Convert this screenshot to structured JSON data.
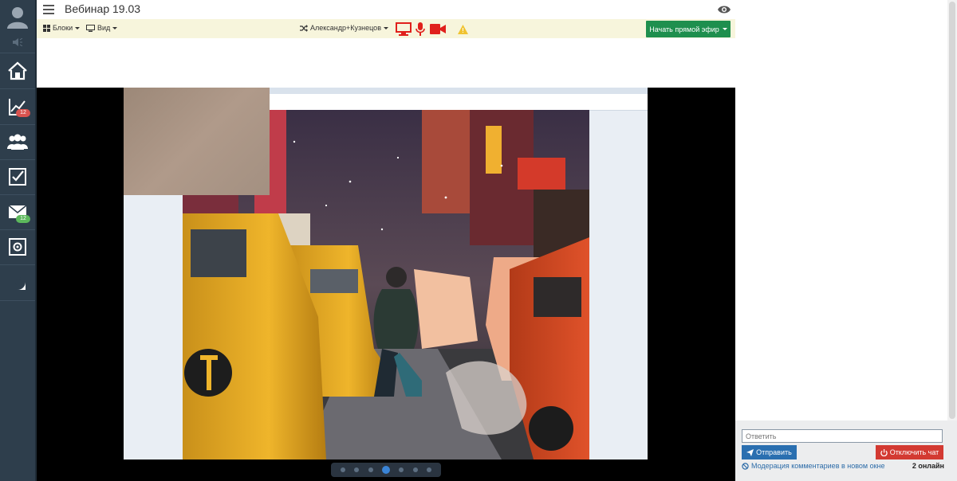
{
  "header": {
    "title": "Вебинар 19.03"
  },
  "sidebar": {
    "items": [
      {
        "icon": "user-avatar-icon"
      },
      {
        "icon": "volume-icon"
      },
      {
        "icon": "home-icon"
      },
      {
        "icon": "chart-icon",
        "badge": "12"
      },
      {
        "icon": "users-icon"
      },
      {
        "icon": "checkbox-icon"
      },
      {
        "icon": "mail-icon",
        "badge": "12"
      },
      {
        "icon": "safe-icon"
      },
      {
        "icon": "brand-logo-icon"
      }
    ],
    "badge_colors": {
      "chart": "#d9534f",
      "mail": "#5cb85c"
    }
  },
  "toolbar": {
    "blocks_label": "Блоки",
    "view_label": "Вид",
    "presenter_label": "Александр+Кузнецов",
    "live_label": "Начать прямой эфир"
  },
  "chat": {
    "reply_placeholder": "Ответить",
    "send_label": "Отправить",
    "disable_label": "Отключить чат",
    "moderation_label": "Модерация комментариев в новом окне",
    "online_label": "2 онлайн"
  },
  "colors": {
    "sidebar_bg": "#2e3e4c",
    "toolbar_bg": "#f7f5dc",
    "live_button": "#1e8f4e",
    "send_button": "#2a6fb0",
    "disable_button": "#d33a32",
    "media_red": "#e0201c"
  }
}
